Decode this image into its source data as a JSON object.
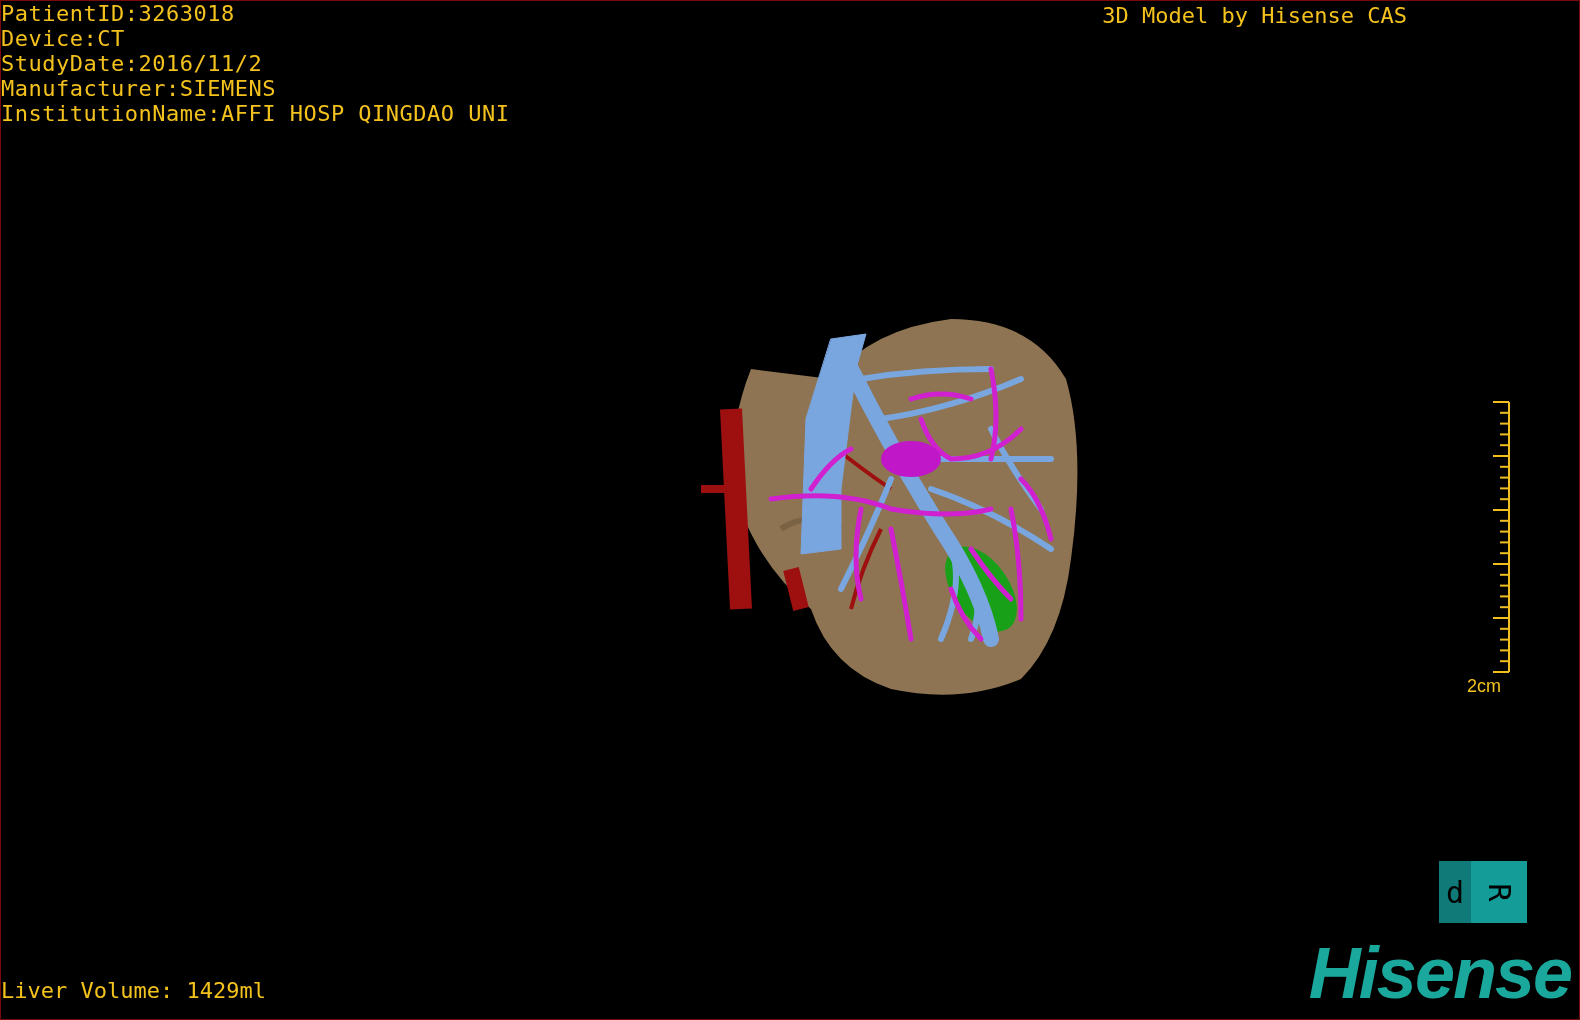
{
  "patient_info": [
    "PatientID:3263018",
    "Device:CT",
    "StudyDate:2016/11/2",
    "Manufacturer:SIEMENS",
    "InstitutionName:AFFI HOSP QINGDAO UNI"
  ],
  "header": "3D Model by Hisense CAS",
  "scale_bar": {
    "label": "2cm"
  },
  "orientation_cube": {
    "left_face": "d",
    "right_face": "R"
  },
  "liver_volume": "Liver Volume: 1429ml",
  "logo": "Hisense"
}
